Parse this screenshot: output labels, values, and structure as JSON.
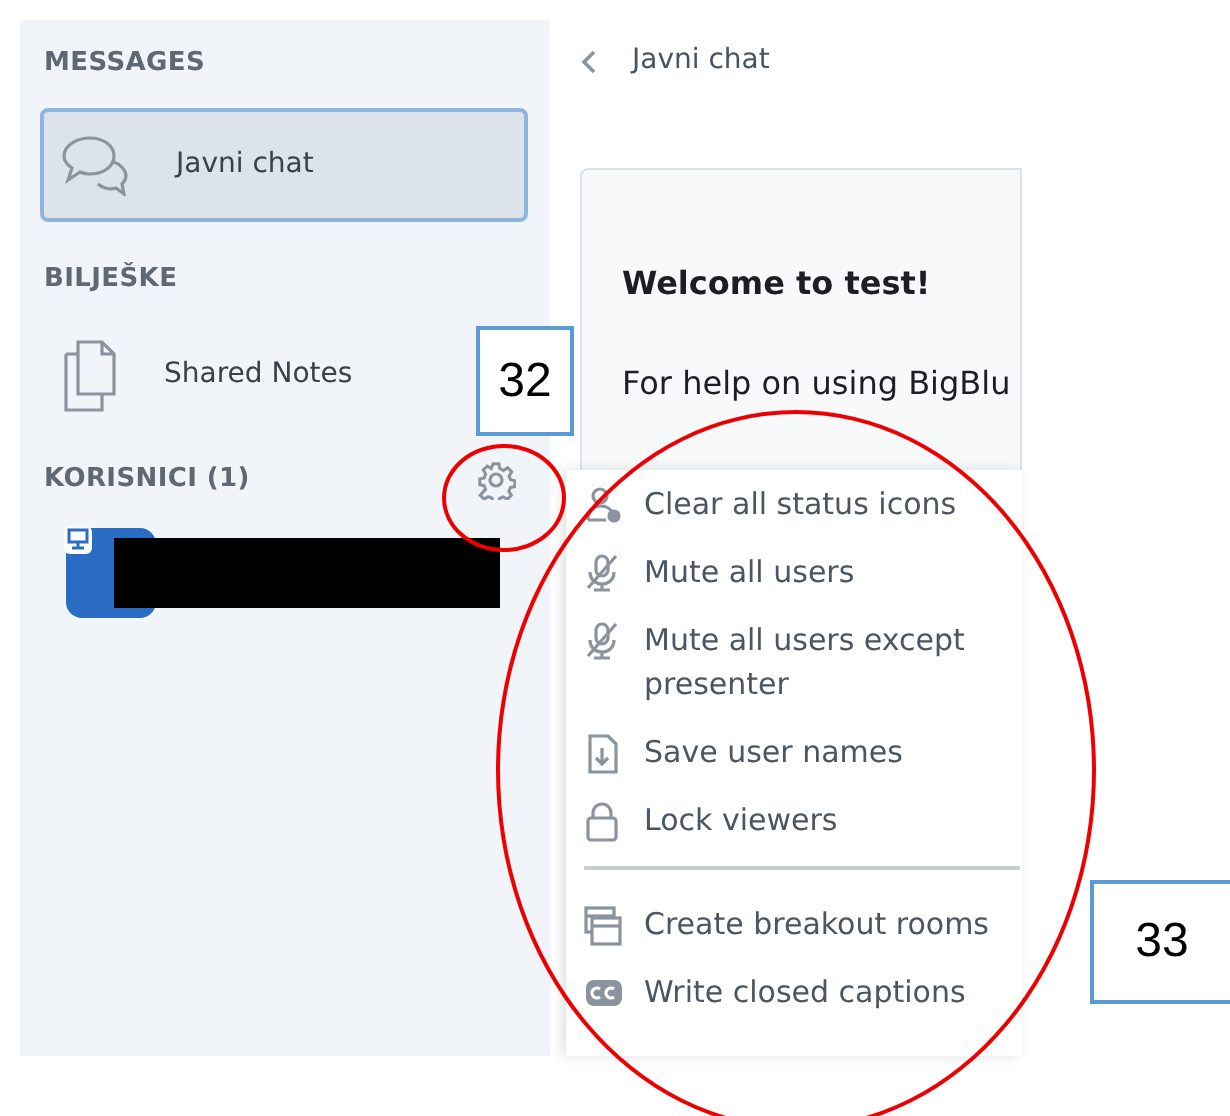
{
  "sidebar": {
    "sections": [
      {
        "heading": "MESSAGES",
        "items": [
          {
            "kind": "chat",
            "label": "Javni chat",
            "selected": true
          }
        ]
      },
      {
        "heading": "BILJEŠKE",
        "items": [
          {
            "kind": "notes",
            "label": "Shared Notes",
            "selected": false
          }
        ]
      }
    ],
    "users": {
      "heading": "KORISNICI (1)",
      "list": [
        {
          "kind": "redacted"
        }
      ]
    }
  },
  "chat": {
    "title": "Javni chat",
    "messages": [
      {
        "text": "Welcome to test!",
        "bold": true
      },
      {
        "text": "For help on using BigBlu",
        "bold": false
      }
    ]
  },
  "menu": {
    "items": [
      {
        "kind": "item",
        "label": "Clear all status icons"
      },
      {
        "kind": "item",
        "label": "Mute all users"
      },
      {
        "kind": "item",
        "label": "Mute all users except presenter"
      },
      {
        "kind": "item",
        "label": "Save user names"
      },
      {
        "kind": "item",
        "label": "Lock viewers"
      },
      {
        "kind": "separator"
      },
      {
        "kind": "item",
        "label": "Create breakout rooms"
      },
      {
        "kind": "item",
        "label": "Write closed captions"
      }
    ]
  },
  "annotations": [
    {
      "kind": "callout",
      "label": "32"
    },
    {
      "kind": "callout",
      "label": "33"
    },
    {
      "kind": "ellipse"
    },
    {
      "kind": "ellipse"
    }
  ]
}
